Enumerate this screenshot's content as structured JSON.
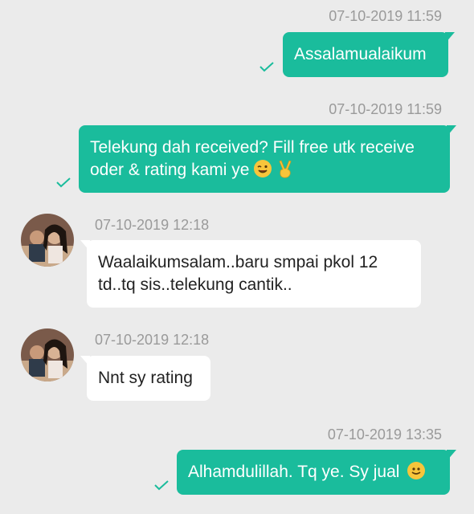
{
  "messages": [
    {
      "time": "07-10-2019 11:59",
      "text": "Assalamualaikum"
    },
    {
      "time": "07-10-2019 11:59",
      "text_line1": "Telekung dah received? Fill free utk receive",
      "text_line2": "oder & rating kami ye",
      "emoji1": "winking-face",
      "emoji2": "victory-hand"
    },
    {
      "time": "07-10-2019 12:18",
      "text_line1": "Waalaikumsalam..baru smpai pkol 12",
      "text_line2": "td..tq sis..telekung cantik.."
    },
    {
      "time": "07-10-2019 12:18",
      "text": "Nnt sy rating"
    },
    {
      "time": "07-10-2019 13:35",
      "text": "Alhamdulillah. Tq ye. Sy jual",
      "emoji": "slightly-smiling-face"
    }
  ],
  "colors": {
    "outgoing": "#1abc9c",
    "incoming": "#ffffff",
    "background": "#ebebeb",
    "timestamp": "#9a9a9a"
  }
}
